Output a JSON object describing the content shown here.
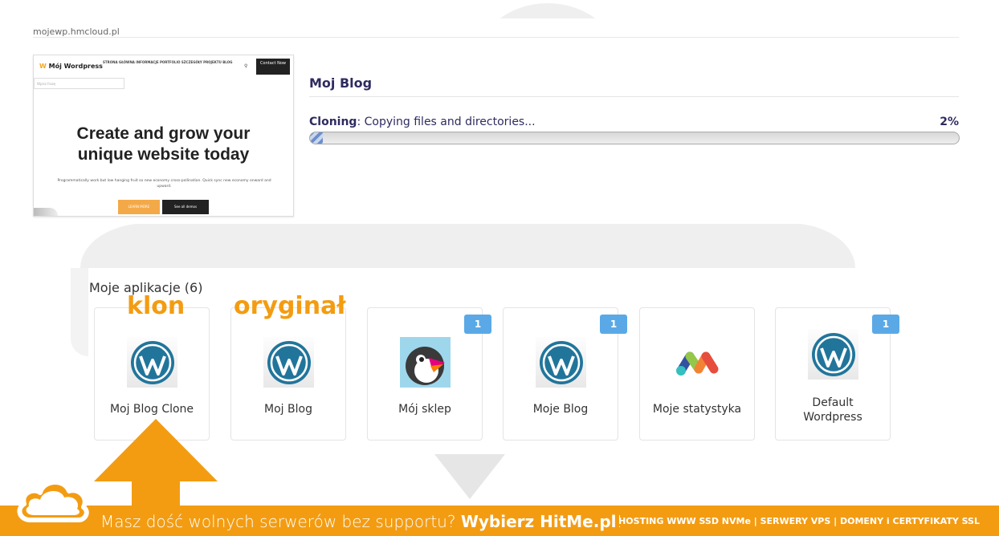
{
  "site": {
    "domain": "mojewp.hmcloud.pl"
  },
  "thumbnail": {
    "logo": "Mój Wordpress",
    "menu": "STRONA GŁÓWNA  INFORMACJE  PORTFOLIO  SZCZEGÓŁY PROJEKTU  BLOG",
    "search_icon": "search-icon",
    "contact": "Contact Now",
    "input_placeholder": "Wpisz frazę",
    "headline_line1": "Create and grow your",
    "headline_line2": "unique website today",
    "subtext": "Programmatically work but low hanging fruit so new economy cross-pollination. Quick sync new economy onward and upward.",
    "btn_learn": "LEARN MORE",
    "btn_demos": "See all demos"
  },
  "clone": {
    "blog_title": "Moj Blog",
    "status_label": "Cloning",
    "status_text": ": Copying files and directories...",
    "percent_text": "2%",
    "progress": 0.02
  },
  "apps": {
    "heading": "Moje aplikacje (6)",
    "items": [
      {
        "label": "Moj Blog Clone",
        "icon": "wordpress-icon",
        "badge": ""
      },
      {
        "label": "Moj Blog",
        "icon": "wordpress-icon",
        "badge": ""
      },
      {
        "label": "Mój sklep",
        "icon": "prestashop-icon",
        "badge": "1"
      },
      {
        "label": "Moje Blog",
        "icon": "wordpress-icon",
        "badge": "1"
      },
      {
        "label": "Moje statystyka",
        "icon": "matomo-icon",
        "badge": ""
      },
      {
        "label": "Default Wordpress",
        "icon": "wordpress-icon",
        "badge": "1"
      }
    ]
  },
  "annotations": {
    "klon": "klon",
    "oryginal": "oryginał"
  },
  "footer": {
    "text_before": "Masz dość wolnych serwerów bez supportu? ",
    "brand": "Wybierz HitMe.pl",
    "text_after": "!",
    "right": "HOSTING WWW SSD NVMe | SERWERY VPS | DOMENY i CERTYFIKATY SSL"
  },
  "colors": {
    "accent": "#f39c12",
    "title": "#2e2b5f",
    "badge": "#5aa9e6",
    "wordpress": "#21759b"
  }
}
